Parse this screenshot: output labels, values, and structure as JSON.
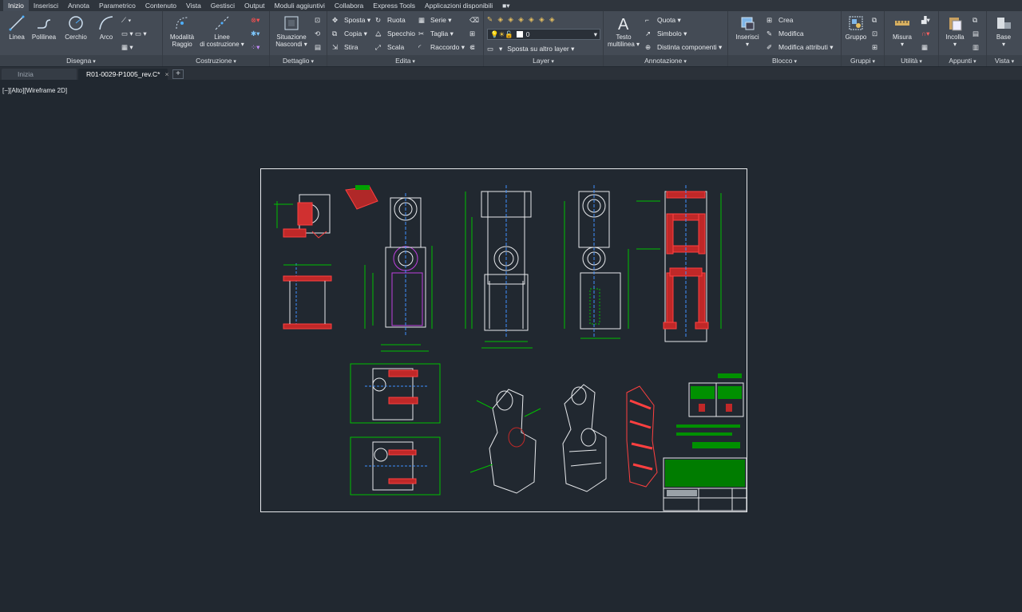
{
  "menu_tabs": [
    "Inizio",
    "Inserisci",
    "Annota",
    "Parametrico",
    "Contenuto",
    "Vista",
    "Gestisci",
    "Output",
    "Moduli aggiuntivi",
    "Collabora",
    "Express Tools",
    "Applicazioni disponibili"
  ],
  "ribbon": {
    "disegna": {
      "title": "Disegna",
      "linea": "Linea",
      "polilinea": "Polilinea",
      "cerchio": "Cerchio",
      "arco": "Arco"
    },
    "costruzione": {
      "title": "Costruzione",
      "modalita": "Modalità",
      "raggio": "Raggio",
      "linee": "Linee",
      "di_costruzione": "di costruzione"
    },
    "dettaglio": {
      "title": "Dettaglio",
      "situazione": "Situazione",
      "nascondi": "Nascondi"
    },
    "edita": {
      "title": "Edita",
      "sposta": "Sposta",
      "ruota": "Ruota",
      "serie": "Serie",
      "copia": "Copia",
      "specchio": "Specchio",
      "taglia": "Taglia",
      "stira": "Stira",
      "scala": "Scala",
      "raccordo": "Raccordo"
    },
    "layer": {
      "title": "Layer",
      "current": "0",
      "sposta_layer": "Sposta su altro layer"
    },
    "annotazione": {
      "title": "Annotazione",
      "testo": "Testo",
      "multilinea": "multilinea",
      "quota": "Quota",
      "simbolo": "Simbolo",
      "distinta": "Distinta componenti"
    },
    "blocco": {
      "title": "Blocco",
      "inserisci": "Inserisci",
      "crea": "Crea",
      "modifica": "Modifica",
      "modifica_attributi": "Modifica attributi"
    },
    "gruppi": {
      "title": "Gruppi",
      "gruppo": "Gruppo"
    },
    "utilita": {
      "title": "Utilità",
      "misura": "Misura"
    },
    "appunti": {
      "title": "Appunti",
      "incolla": "Incolla"
    },
    "vista": {
      "title": "Vista",
      "base": "Base"
    }
  },
  "doc_tabs": {
    "start": "Inizia",
    "active": "R01-0029-P1005_rev.C*"
  },
  "viewport_label": "[−][Alto][Wireframe 2D]",
  "colors": {
    "background": "#212830",
    "ribbon": "#444b55",
    "line": "#e7e9ec",
    "dimension": "#00c000",
    "hatch": "#e03030",
    "accent": "#c040e0"
  }
}
